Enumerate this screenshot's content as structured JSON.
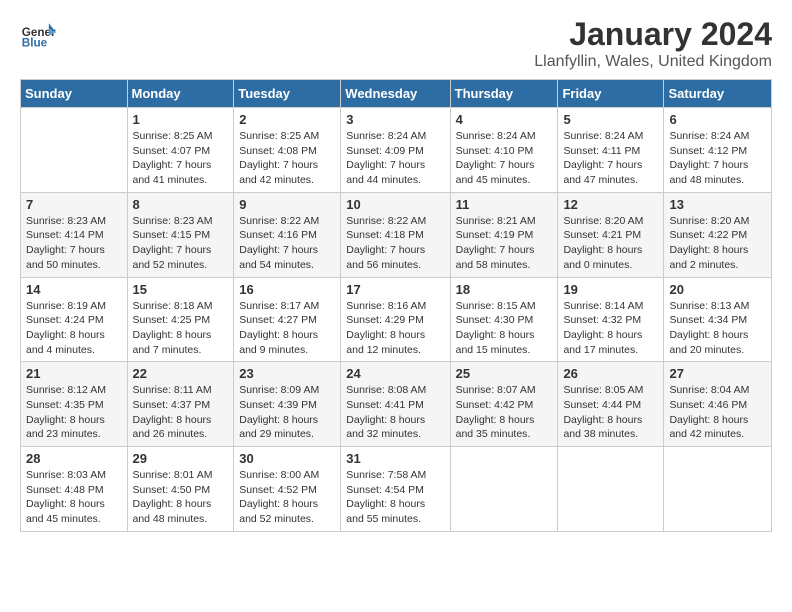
{
  "logo": {
    "text_general": "General",
    "text_blue": "Blue"
  },
  "header": {
    "month": "January 2024",
    "location": "Llanfyllin, Wales, United Kingdom"
  },
  "days_of_week": [
    "Sunday",
    "Monday",
    "Tuesday",
    "Wednesday",
    "Thursday",
    "Friday",
    "Saturday"
  ],
  "weeks": [
    [
      {
        "day": "",
        "sunrise": "",
        "sunset": "",
        "daylight": ""
      },
      {
        "day": "1",
        "sunrise": "Sunrise: 8:25 AM",
        "sunset": "Sunset: 4:07 PM",
        "daylight": "Daylight: 7 hours and 41 minutes."
      },
      {
        "day": "2",
        "sunrise": "Sunrise: 8:25 AM",
        "sunset": "Sunset: 4:08 PM",
        "daylight": "Daylight: 7 hours and 42 minutes."
      },
      {
        "day": "3",
        "sunrise": "Sunrise: 8:24 AM",
        "sunset": "Sunset: 4:09 PM",
        "daylight": "Daylight: 7 hours and 44 minutes."
      },
      {
        "day": "4",
        "sunrise": "Sunrise: 8:24 AM",
        "sunset": "Sunset: 4:10 PM",
        "daylight": "Daylight: 7 hours and 45 minutes."
      },
      {
        "day": "5",
        "sunrise": "Sunrise: 8:24 AM",
        "sunset": "Sunset: 4:11 PM",
        "daylight": "Daylight: 7 hours and 47 minutes."
      },
      {
        "day": "6",
        "sunrise": "Sunrise: 8:24 AM",
        "sunset": "Sunset: 4:12 PM",
        "daylight": "Daylight: 7 hours and 48 minutes."
      }
    ],
    [
      {
        "day": "7",
        "sunrise": "Sunrise: 8:23 AM",
        "sunset": "Sunset: 4:14 PM",
        "daylight": "Daylight: 7 hours and 50 minutes."
      },
      {
        "day": "8",
        "sunrise": "Sunrise: 8:23 AM",
        "sunset": "Sunset: 4:15 PM",
        "daylight": "Daylight: 7 hours and 52 minutes."
      },
      {
        "day": "9",
        "sunrise": "Sunrise: 8:22 AM",
        "sunset": "Sunset: 4:16 PM",
        "daylight": "Daylight: 7 hours and 54 minutes."
      },
      {
        "day": "10",
        "sunrise": "Sunrise: 8:22 AM",
        "sunset": "Sunset: 4:18 PM",
        "daylight": "Daylight: 7 hours and 56 minutes."
      },
      {
        "day": "11",
        "sunrise": "Sunrise: 8:21 AM",
        "sunset": "Sunset: 4:19 PM",
        "daylight": "Daylight: 7 hours and 58 minutes."
      },
      {
        "day": "12",
        "sunrise": "Sunrise: 8:20 AM",
        "sunset": "Sunset: 4:21 PM",
        "daylight": "Daylight: 8 hours and 0 minutes."
      },
      {
        "day": "13",
        "sunrise": "Sunrise: 8:20 AM",
        "sunset": "Sunset: 4:22 PM",
        "daylight": "Daylight: 8 hours and 2 minutes."
      }
    ],
    [
      {
        "day": "14",
        "sunrise": "Sunrise: 8:19 AM",
        "sunset": "Sunset: 4:24 PM",
        "daylight": "Daylight: 8 hours and 4 minutes."
      },
      {
        "day": "15",
        "sunrise": "Sunrise: 8:18 AM",
        "sunset": "Sunset: 4:25 PM",
        "daylight": "Daylight: 8 hours and 7 minutes."
      },
      {
        "day": "16",
        "sunrise": "Sunrise: 8:17 AM",
        "sunset": "Sunset: 4:27 PM",
        "daylight": "Daylight: 8 hours and 9 minutes."
      },
      {
        "day": "17",
        "sunrise": "Sunrise: 8:16 AM",
        "sunset": "Sunset: 4:29 PM",
        "daylight": "Daylight: 8 hours and 12 minutes."
      },
      {
        "day": "18",
        "sunrise": "Sunrise: 8:15 AM",
        "sunset": "Sunset: 4:30 PM",
        "daylight": "Daylight: 8 hours and 15 minutes."
      },
      {
        "day": "19",
        "sunrise": "Sunrise: 8:14 AM",
        "sunset": "Sunset: 4:32 PM",
        "daylight": "Daylight: 8 hours and 17 minutes."
      },
      {
        "day": "20",
        "sunrise": "Sunrise: 8:13 AM",
        "sunset": "Sunset: 4:34 PM",
        "daylight": "Daylight: 8 hours and 20 minutes."
      }
    ],
    [
      {
        "day": "21",
        "sunrise": "Sunrise: 8:12 AM",
        "sunset": "Sunset: 4:35 PM",
        "daylight": "Daylight: 8 hours and 23 minutes."
      },
      {
        "day": "22",
        "sunrise": "Sunrise: 8:11 AM",
        "sunset": "Sunset: 4:37 PM",
        "daylight": "Daylight: 8 hours and 26 minutes."
      },
      {
        "day": "23",
        "sunrise": "Sunrise: 8:09 AM",
        "sunset": "Sunset: 4:39 PM",
        "daylight": "Daylight: 8 hours and 29 minutes."
      },
      {
        "day": "24",
        "sunrise": "Sunrise: 8:08 AM",
        "sunset": "Sunset: 4:41 PM",
        "daylight": "Daylight: 8 hours and 32 minutes."
      },
      {
        "day": "25",
        "sunrise": "Sunrise: 8:07 AM",
        "sunset": "Sunset: 4:42 PM",
        "daylight": "Daylight: 8 hours and 35 minutes."
      },
      {
        "day": "26",
        "sunrise": "Sunrise: 8:05 AM",
        "sunset": "Sunset: 4:44 PM",
        "daylight": "Daylight: 8 hours and 38 minutes."
      },
      {
        "day": "27",
        "sunrise": "Sunrise: 8:04 AM",
        "sunset": "Sunset: 4:46 PM",
        "daylight": "Daylight: 8 hours and 42 minutes."
      }
    ],
    [
      {
        "day": "28",
        "sunrise": "Sunrise: 8:03 AM",
        "sunset": "Sunset: 4:48 PM",
        "daylight": "Daylight: 8 hours and 45 minutes."
      },
      {
        "day": "29",
        "sunrise": "Sunrise: 8:01 AM",
        "sunset": "Sunset: 4:50 PM",
        "daylight": "Daylight: 8 hours and 48 minutes."
      },
      {
        "day": "30",
        "sunrise": "Sunrise: 8:00 AM",
        "sunset": "Sunset: 4:52 PM",
        "daylight": "Daylight: 8 hours and 52 minutes."
      },
      {
        "day": "31",
        "sunrise": "Sunrise: 7:58 AM",
        "sunset": "Sunset: 4:54 PM",
        "daylight": "Daylight: 8 hours and 55 minutes."
      },
      {
        "day": "",
        "sunrise": "",
        "sunset": "",
        "daylight": ""
      },
      {
        "day": "",
        "sunrise": "",
        "sunset": "",
        "daylight": ""
      },
      {
        "day": "",
        "sunrise": "",
        "sunset": "",
        "daylight": ""
      }
    ]
  ]
}
